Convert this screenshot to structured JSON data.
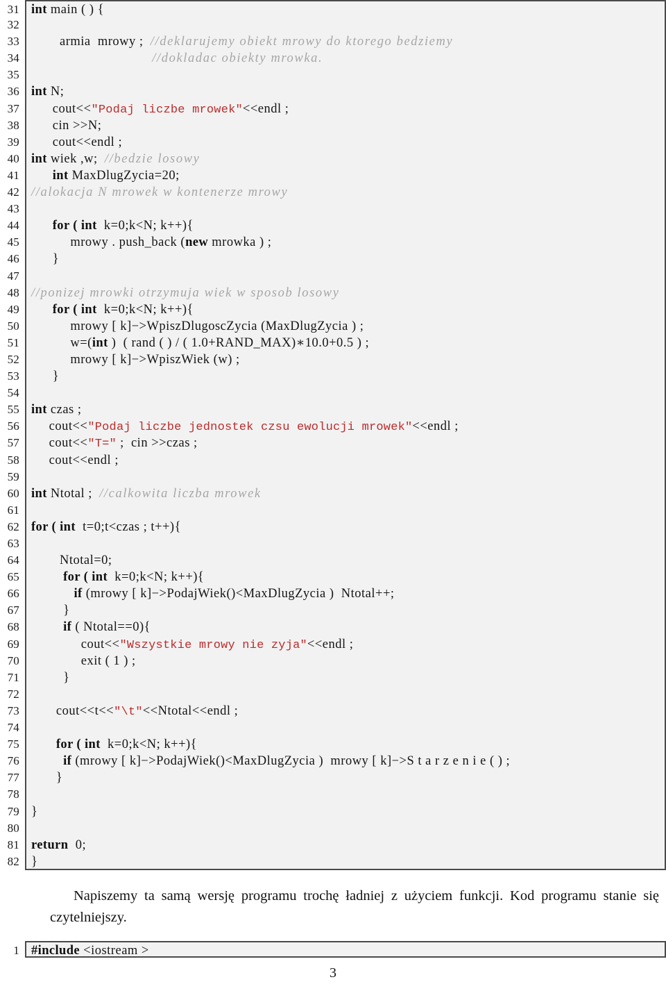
{
  "document": {
    "page_number": "3",
    "paragraph": "Napiszemy ta samą wersję programu trochę ładniej z użyciem funkcji. Kod programu stanie się czytelniejszy.",
    "colors": {
      "string_literal": "#bc2c2c",
      "comment": "#a6a6a6",
      "code_background": "#f2f2f2",
      "code_border": "#4a4a4a",
      "text": "#111111"
    }
  },
  "listing_main": {
    "first_line_number": 31,
    "last_line_number": 82,
    "lines": [
      {
        "n": "31",
        "tokens": [
          {
            "t": "kw",
            "v": "int"
          },
          {
            "t": "id",
            "v": " main ( ) {"
          }
        ]
      },
      {
        "n": "32",
        "tokens": []
      },
      {
        "n": "33",
        "tokens": [
          {
            "t": "id",
            "v": "        armia  mrowy ;  "
          },
          {
            "t": "cmt",
            "v": "//deklarujemy obiekt mrowy do ktorego bedziemy"
          }
        ]
      },
      {
        "n": "34",
        "tokens": [
          {
            "t": "cmt",
            "v": "                            //dokladac obiekty mrowka."
          }
        ]
      },
      {
        "n": "35",
        "tokens": []
      },
      {
        "n": "36",
        "tokens": [
          {
            "t": "kw",
            "v": "int"
          },
          {
            "t": "id",
            "v": " N;"
          }
        ]
      },
      {
        "n": "37",
        "tokens": [
          {
            "t": "id",
            "v": "      cout<<"
          },
          {
            "t": "str",
            "v": "\"Podaj liczbe mrowek\""
          },
          {
            "t": "id",
            "v": "<<endl ;"
          }
        ]
      },
      {
        "n": "38",
        "tokens": [
          {
            "t": "id",
            "v": "      cin >>N;"
          }
        ]
      },
      {
        "n": "39",
        "tokens": [
          {
            "t": "id",
            "v": "      cout<<endl ;"
          }
        ]
      },
      {
        "n": "40",
        "tokens": [
          {
            "t": "kw",
            "v": "int"
          },
          {
            "t": "id",
            "v": " wiek ,w;  "
          },
          {
            "t": "cmt",
            "v": "//bedzie losowy"
          }
        ]
      },
      {
        "n": "41",
        "tokens": [
          {
            "t": "id",
            "v": "      "
          },
          {
            "t": "kw",
            "v": "int"
          },
          {
            "t": "id",
            "v": " MaxDlugZycia=20;"
          }
        ]
      },
      {
        "n": "42",
        "tokens": [
          {
            "t": "cmt",
            "v": "//alokacja N mrowek w kontenerze mrowy"
          }
        ]
      },
      {
        "n": "43",
        "tokens": []
      },
      {
        "n": "44",
        "tokens": [
          {
            "t": "id",
            "v": "      "
          },
          {
            "t": "kw",
            "v": "for ( int"
          },
          {
            "t": "id",
            "v": "  k=0;k<N; k++){"
          }
        ]
      },
      {
        "n": "45",
        "tokens": [
          {
            "t": "id",
            "v": "           mrowy . push_back ("
          },
          {
            "t": "kw",
            "v": "new"
          },
          {
            "t": "id",
            "v": " mrowka ) ;"
          }
        ]
      },
      {
        "n": "46",
        "tokens": [
          {
            "t": "id",
            "v": "      }"
          }
        ]
      },
      {
        "n": "47",
        "tokens": []
      },
      {
        "n": "48",
        "tokens": [
          {
            "t": "cmt",
            "v": "//ponizej mrowki otrzymuja wiek w sposob losowy"
          }
        ]
      },
      {
        "n": "49",
        "tokens": [
          {
            "t": "id",
            "v": "      "
          },
          {
            "t": "kw",
            "v": "for ( int"
          },
          {
            "t": "id",
            "v": "  k=0;k<N; k++){"
          }
        ]
      },
      {
        "n": "50",
        "tokens": [
          {
            "t": "id",
            "v": "           mrowy [ k]−>WpiszDlugoscZycia (MaxDlugZycia ) ;"
          }
        ]
      },
      {
        "n": "51",
        "tokens": [
          {
            "t": "id",
            "v": "           w=("
          },
          {
            "t": "kw",
            "v": "int"
          },
          {
            "t": "id",
            "v": " )  ( rand ( ) / ( 1.0+RAND_MAX)∗10.0+0.5 ) ;"
          }
        ]
      },
      {
        "n": "52",
        "tokens": [
          {
            "t": "id",
            "v": "           mrowy [ k]−>WpiszWiek (w) ;"
          }
        ]
      },
      {
        "n": "53",
        "tokens": [
          {
            "t": "id",
            "v": "      }"
          }
        ]
      },
      {
        "n": "54",
        "tokens": []
      },
      {
        "n": "55",
        "tokens": [
          {
            "t": "kw",
            "v": "int"
          },
          {
            "t": "id",
            "v": " czas ;"
          }
        ]
      },
      {
        "n": "56",
        "tokens": [
          {
            "t": "id",
            "v": "     cout<<"
          },
          {
            "t": "str",
            "v": "\"Podaj liczbe jednostek czsu ewolucji mrowek\""
          },
          {
            "t": "id",
            "v": "<<endl ;"
          }
        ]
      },
      {
        "n": "57",
        "tokens": [
          {
            "t": "id",
            "v": "     cout<<"
          },
          {
            "t": "str",
            "v": "\"T=\""
          },
          {
            "t": "id",
            "v": " ;  cin >>czas ;"
          }
        ]
      },
      {
        "n": "58",
        "tokens": [
          {
            "t": "id",
            "v": "     cout<<endl ;"
          }
        ]
      },
      {
        "n": "59",
        "tokens": []
      },
      {
        "n": "60",
        "tokens": [
          {
            "t": "kw",
            "v": "int"
          },
          {
            "t": "id",
            "v": " Ntotal ;  "
          },
          {
            "t": "cmt",
            "v": "//calkowita liczba mrowek"
          }
        ]
      },
      {
        "n": "61",
        "tokens": []
      },
      {
        "n": "62",
        "tokens": [
          {
            "t": "kw",
            "v": "for ( int"
          },
          {
            "t": "id",
            "v": "  t=0;t<czas ; t++){"
          }
        ]
      },
      {
        "n": "63",
        "tokens": []
      },
      {
        "n": "64",
        "tokens": [
          {
            "t": "id",
            "v": "        Ntotal=0;"
          }
        ]
      },
      {
        "n": "65",
        "tokens": [
          {
            "t": "id",
            "v": "         "
          },
          {
            "t": "kw",
            "v": "for ( int"
          },
          {
            "t": "id",
            "v": "  k=0;k<N; k++){"
          }
        ]
      },
      {
        "n": "66",
        "tokens": [
          {
            "t": "id",
            "v": "            "
          },
          {
            "t": "kw",
            "v": "if"
          },
          {
            "t": "id",
            "v": " (mrowy [ k]−>PodajWiek()<MaxDlugZycia )  Ntotal++;"
          }
        ]
      },
      {
        "n": "67",
        "tokens": [
          {
            "t": "id",
            "v": "         }"
          }
        ]
      },
      {
        "n": "68",
        "tokens": [
          {
            "t": "id",
            "v": "         "
          },
          {
            "t": "kw",
            "v": "if"
          },
          {
            "t": "id",
            "v": " ( Ntotal==0){"
          }
        ]
      },
      {
        "n": "69",
        "tokens": [
          {
            "t": "id",
            "v": "              cout<<"
          },
          {
            "t": "str",
            "v": "\"Wszystkie mrowy nie zyja\""
          },
          {
            "t": "id",
            "v": "<<endl ;"
          }
        ]
      },
      {
        "n": "70",
        "tokens": [
          {
            "t": "id",
            "v": "              exit ( 1 ) ;"
          }
        ]
      },
      {
        "n": "71",
        "tokens": [
          {
            "t": "id",
            "v": "         }"
          }
        ]
      },
      {
        "n": "72",
        "tokens": []
      },
      {
        "n": "73",
        "tokens": [
          {
            "t": "id",
            "v": "       cout<<t<<"
          },
          {
            "t": "str",
            "v": "\"\\t\""
          },
          {
            "t": "id",
            "v": "<<Ntotal<<endl ;"
          }
        ]
      },
      {
        "n": "74",
        "tokens": []
      },
      {
        "n": "75",
        "tokens": [
          {
            "t": "id",
            "v": "       "
          },
          {
            "t": "kw",
            "v": "for ( int"
          },
          {
            "t": "id",
            "v": "  k=0;k<N; k++){"
          }
        ]
      },
      {
        "n": "76",
        "tokens": [
          {
            "t": "id",
            "v": "         "
          },
          {
            "t": "kw",
            "v": "if"
          },
          {
            "t": "id",
            "v": " (mrowy [ k]−>PodajWiek()<MaxDlugZycia )  mrowy [ k]−>S t a r z e n i e ( ) ;"
          }
        ]
      },
      {
        "n": "77",
        "tokens": [
          {
            "t": "id",
            "v": "       }"
          }
        ]
      },
      {
        "n": "78",
        "tokens": []
      },
      {
        "n": "79",
        "tokens": [
          {
            "t": "id",
            "v": "}"
          }
        ]
      },
      {
        "n": "80",
        "tokens": []
      },
      {
        "n": "81",
        "tokens": [
          {
            "t": "kw",
            "v": "return"
          },
          {
            "t": "id",
            "v": "  0;"
          }
        ]
      },
      {
        "n": "82",
        "tokens": [
          {
            "t": "id",
            "v": "}"
          }
        ]
      }
    ]
  },
  "listing_second": {
    "first_line_number": 1,
    "lines": [
      {
        "n": "1",
        "tokens": [
          {
            "t": "kw",
            "v": "#include"
          },
          {
            "t": "id",
            "v": " <iostream >"
          }
        ]
      }
    ]
  }
}
